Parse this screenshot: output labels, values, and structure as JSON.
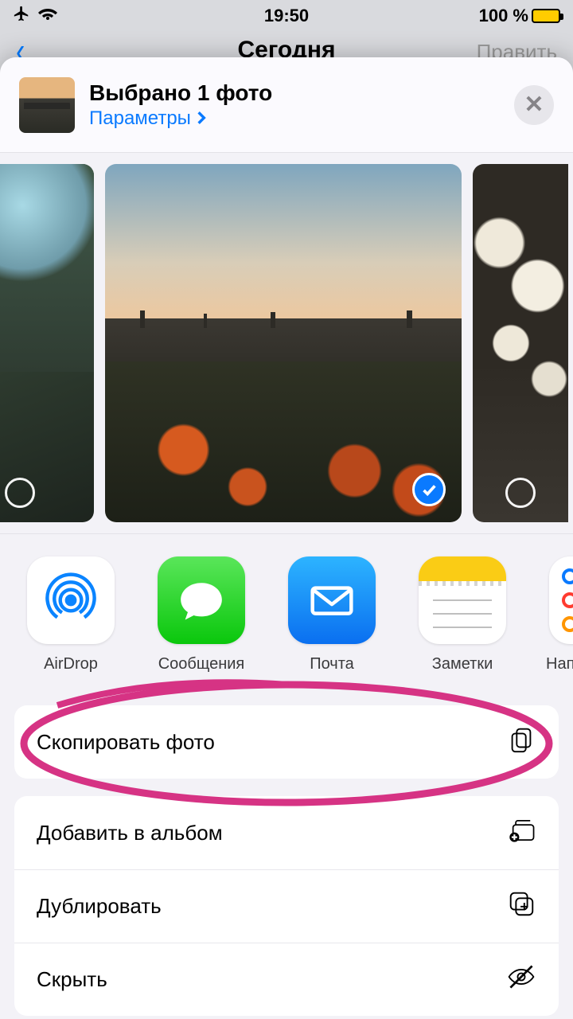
{
  "status": {
    "time": "19:50",
    "battery": "100 %"
  },
  "background": {
    "title": "Сегодня",
    "edit": "Править"
  },
  "header": {
    "title": "Выбрано 1 фото",
    "options": "Параметры"
  },
  "apps": [
    {
      "id": "airdrop",
      "label": "AirDrop"
    },
    {
      "id": "messages",
      "label": "Сообщения"
    },
    {
      "id": "mail",
      "label": "Почта"
    },
    {
      "id": "notes",
      "label": "Заметки"
    },
    {
      "id": "reminders",
      "label": "Напоминания"
    }
  ],
  "actions": {
    "copy": "Скопировать фото",
    "add_album": "Добавить в альбом",
    "duplicate": "Дублировать",
    "hide": "Скрыть"
  }
}
